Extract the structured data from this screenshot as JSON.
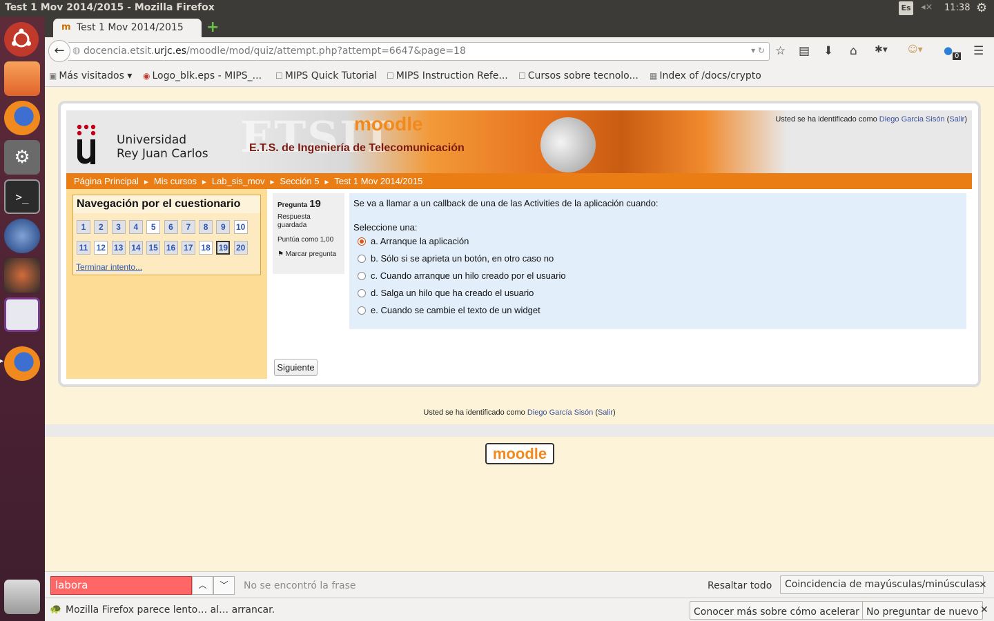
{
  "panel": {
    "window_title": "Test 1 Mov 2014/2015 - Mozilla Firefox",
    "keyboard_layout": "Es",
    "clock": "11:38"
  },
  "browser": {
    "tab_title": "Test 1 Mov 2014/2015",
    "url_domain_pre": "docencia.etsit.",
    "url_domain": "urjc.es",
    "url_path": "/moodle/mod/quiz/attempt.php?attempt=6647&page=18",
    "notification_count": "0",
    "bookmarks": [
      {
        "label": "Más visitados ▾",
        "icon": "folder-icon"
      },
      {
        "label": "Logo_blk.eps - MIPS_...",
        "icon": "shield-icon"
      },
      {
        "label": "MIPS Quick Tutorial",
        "icon": "page-icon"
      },
      {
        "label": "MIPS Instruction Refe...",
        "icon": "page-icon"
      },
      {
        "label": "Cursos sobre tecnolo...",
        "icon": "page-icon"
      },
      {
        "label": "Index of /docs/crypto",
        "icon": "image-icon"
      }
    ]
  },
  "header": {
    "university_line1": "Universidad",
    "university_line2": "Rey Juan Carlos",
    "banner_big": "ETSIT",
    "banner_sub": "E.T.S. de Ingeniería de Telecomunicación",
    "banner_moodle": "moodle",
    "login_prefix": "Usted se ha identificado como",
    "user_name_top": "Diego Garcia Sisón",
    "logout": "Salir"
  },
  "breadcrumb": [
    "Página Principal",
    "Mis cursos",
    "Lab_sis_mov",
    "Sección 5",
    "Test 1 Mov 2014/2015"
  ],
  "quiz_nav": {
    "title": "Navegación por el cuestionario",
    "questions": [
      "1",
      "2",
      "3",
      "4",
      "5",
      "6",
      "7",
      "8",
      "9",
      "10",
      "11",
      "12",
      "13",
      "14",
      "15",
      "16",
      "17",
      "18",
      "19",
      "20"
    ],
    "not_yet_answered": [
      "5",
      "10",
      "12",
      "18"
    ],
    "current": "19",
    "finish_link": "Terminar intento..."
  },
  "question": {
    "label": "Pregunta",
    "number": "19",
    "status": "Respuesta guardada",
    "points": "Puntúa como 1,00",
    "flag": "Marcar pregunta",
    "text": "Se va a llamar a un callback de una de las Activities de la aplicación cuando:",
    "prompt": "Seleccione una:",
    "options": [
      "a. Arranque la aplicación",
      "b. Sólo si se aprieta un botón, en otro caso no",
      "c. Cuando arranque un hilo creado por el usuario",
      "d. Salga un hilo que ha creado el usuario",
      "e. Cuando se cambie el texto de un widget"
    ],
    "selected_index": 0,
    "next_button": "Siguiente"
  },
  "footer": {
    "login_prefix": "Usted se ha identificado como",
    "user_name": "Diego García Sisón",
    "logout": "Salir",
    "logo": "moodle"
  },
  "findbar": {
    "query": "labora",
    "status": "No se encontró la frase",
    "highlight_all": "Resaltar todo",
    "match_case": "Coincidencia de mayúsculas/minúsculas"
  },
  "notification": {
    "message": "Mozilla Firefox parece lento… al… arrancar.",
    "learn_more": "Conocer más sobre cómo acelerar",
    "dont_ask": "No preguntar de nuevo"
  },
  "colors": {
    "accent_orange": "#ea7d13",
    "link_blue": "#2a57b5",
    "launcher_bg": "#5e2b3a",
    "find_error": "#ff6666"
  }
}
